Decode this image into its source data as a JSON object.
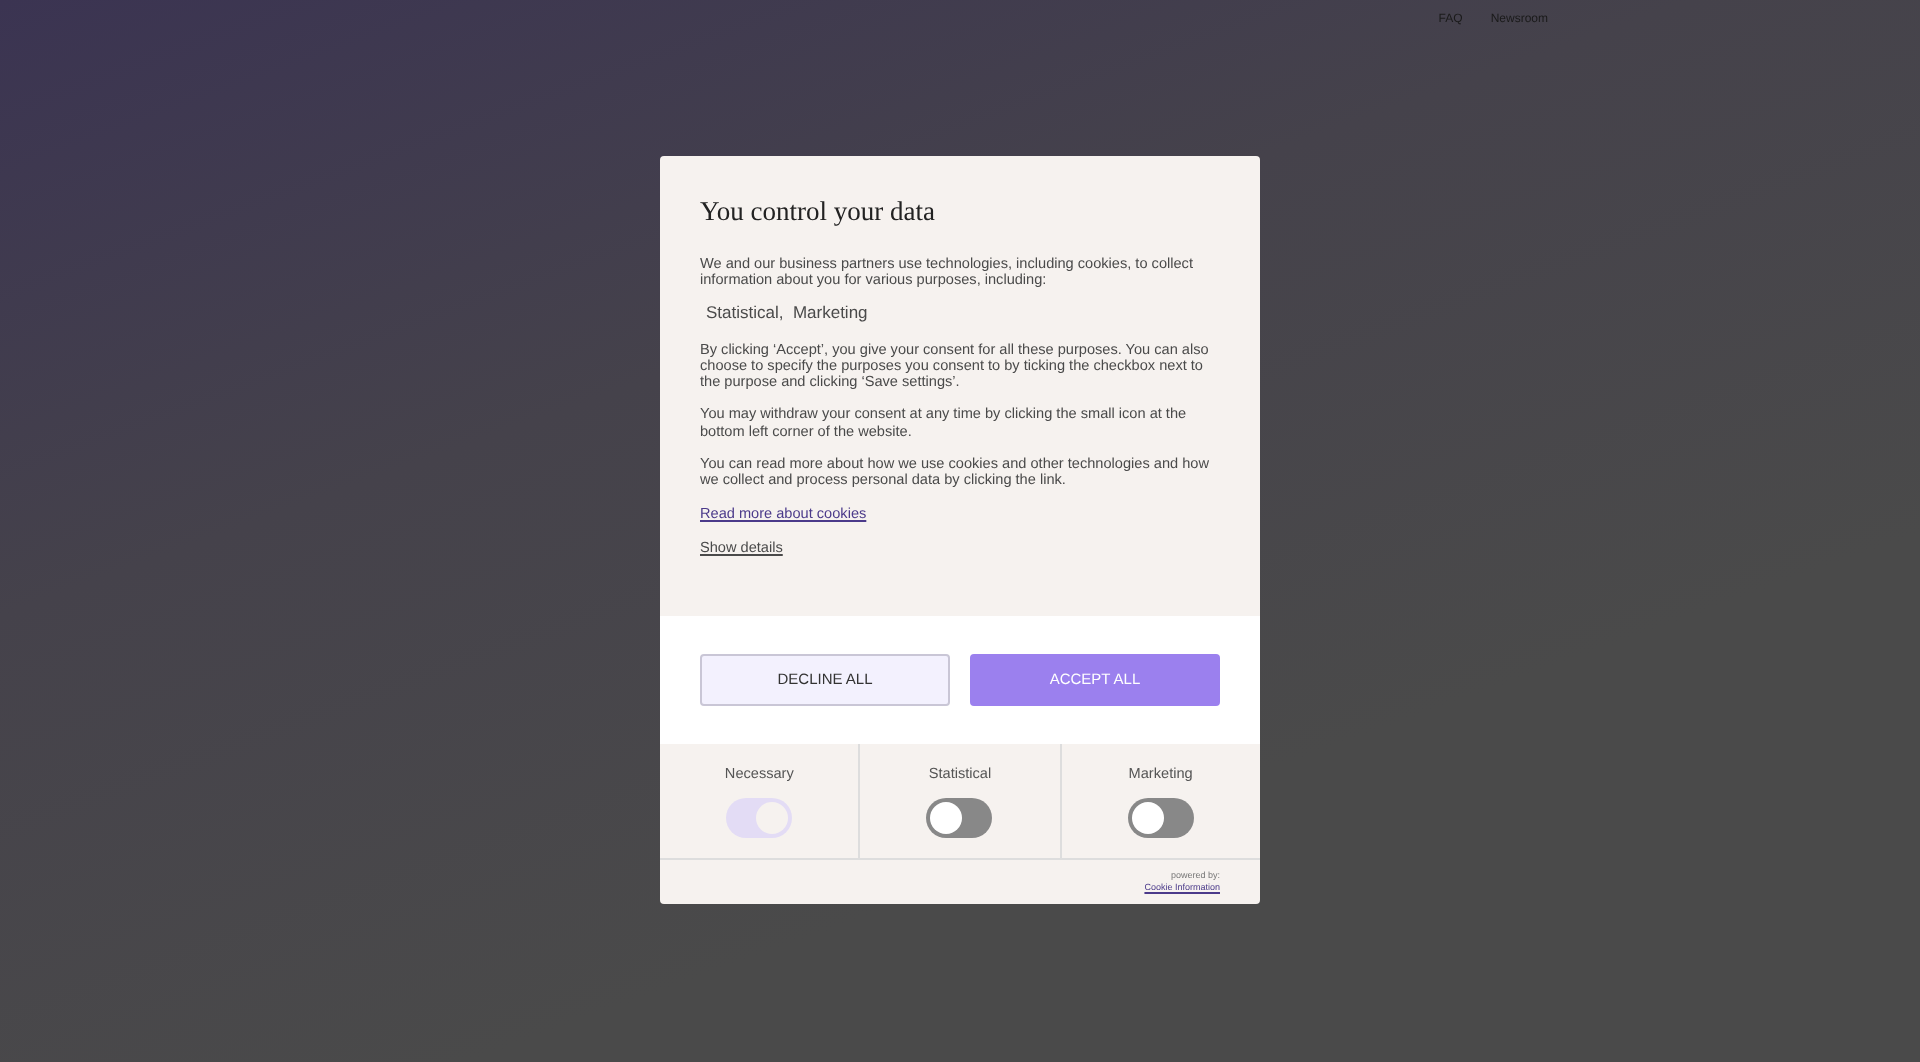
{
  "nav": [
    {
      "label": "FAQ"
    },
    {
      "label": "Newsroom"
    }
  ],
  "dialog": {
    "title": "You control your data",
    "intro": "We and our business partners use technologies, including cookies, to collect information about you for various purposes, including:",
    "purposes": "Statistical,  Marketing",
    "paragraphs": [
      "By clicking ‘Accept’, you give your consent for all these purposes. You can also choose to specify the purposes you consent to by ticking the checkbox next to the purpose and clicking ‘Save settings’.",
      "You may withdraw your consent at any time by clicking the small icon at the bottom left corner of the website.",
      "You can read more about how we use cookies and other technologies and how we collect and process personal data by clicking the link."
    ],
    "read_more_link": "Read more about cookies",
    "show_details_link": "Show details",
    "buttons": [
      {
        "label": "DECLINE ALL",
        "kind": "secondary"
      },
      {
        "label": "ACCEPT ALL",
        "kind": "primary"
      }
    ],
    "toggles": [
      {
        "label": "Necessary",
        "on": true,
        "disabled": true
      },
      {
        "label": "Statistical",
        "on": false,
        "disabled": false
      },
      {
        "label": "Marketing",
        "on": false,
        "disabled": false
      }
    ],
    "powered_by": "powered by:",
    "powered_link": "Cookie Information"
  }
}
